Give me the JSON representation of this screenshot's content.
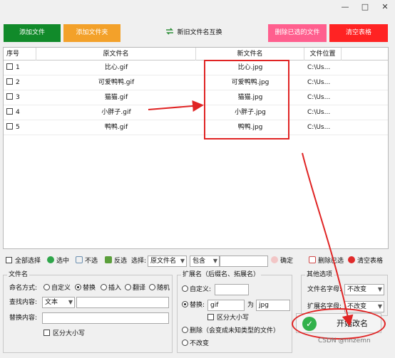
{
  "window": {
    "min": "—",
    "max": "□",
    "close": "✕"
  },
  "toolbar": {
    "add_file": "添加文件",
    "add_folder": "添加文件夹",
    "swap_names": "新旧文件名互换",
    "delete_selected": "删除已选的文件",
    "clear_table": "清空表格"
  },
  "table": {
    "columns": [
      "序号",
      "原文件名",
      "新文件名",
      "文件位置"
    ],
    "rows": [
      {
        "idx": "1",
        "orig": "比心.gif",
        "new": "比心.jpg",
        "loc": "C:\\Us..."
      },
      {
        "idx": "2",
        "orig": "可爱鸭鸭.gif",
        "new": "可爱鸭鸭.jpg",
        "loc": "C:\\Us..."
      },
      {
        "idx": "3",
        "orig": "猫猫.gif",
        "new": "猫猫.jpg",
        "loc": "C:\\Us..."
      },
      {
        "idx": "4",
        "orig": "小胖子.gif",
        "new": "小胖子.jpg",
        "loc": "C:\\Us..."
      },
      {
        "idx": "5",
        "orig": "鸭鸭.gif",
        "new": "鸭鸭.jpg",
        "loc": "C:\\Us..."
      }
    ]
  },
  "selection_bar": {
    "select_all": "全部选择",
    "select": "选中",
    "deselect": "不选",
    "invert": "反选",
    "choose_label": "选择:",
    "field_value": "原文件名",
    "mode_value": "包含",
    "input_value": "",
    "confirm": "确定",
    "delete_selected": "删除已选",
    "clear_table": "清空表格"
  },
  "filename_group": {
    "title": "文件名",
    "naming_mode_label": "命名方式:",
    "modes": [
      "自定义",
      "替换",
      "插入",
      "翻译",
      "随机"
    ],
    "active_mode": "替换",
    "find_label": "查找内容:",
    "find_type": "文本",
    "find_value": "",
    "replace_label": "替换内容:",
    "replace_value": "",
    "case_label": "区分大小写"
  },
  "ext_group": {
    "title": "扩展名（后缀名、拓展名）",
    "custom_label": "自定义:",
    "custom_value": "",
    "replace_label": "替换:",
    "replace_from": "gif",
    "as_label": "为",
    "replace_to": "jpg",
    "case_label": "区分大小写",
    "delete_label": "删除（会变成未知类型的文件）",
    "unchanged_label": "不改变",
    "active": "替换"
  },
  "other_group": {
    "title": "其他选项",
    "filename_letter_label": "文件名字母:",
    "filename_letter_value": "不改变",
    "ext_letter_label": "扩展名字母:",
    "ext_letter_value": "不改变"
  },
  "start_button": {
    "label": "开始改名"
  },
  "watermark": "CSDN @nnzemn",
  "colors": {
    "add_file_bg": "#118a2a",
    "add_folder_bg": "#f3a12a",
    "delete_selected_bg": "#ff5f8e",
    "clear_table_bg": "#ff2323",
    "annotation": "#e02424"
  },
  "icons": {
    "swap": "swap-arrows-icon",
    "select": "check-circle-icon",
    "deselect": "anchor-icon",
    "invert": "invert-arrows-icon",
    "confirm": "confirm-icon",
    "delete_selected": "delete-selected-icon",
    "clear_table": "clear-x-icon",
    "start": "checkmark-circle-icon"
  }
}
